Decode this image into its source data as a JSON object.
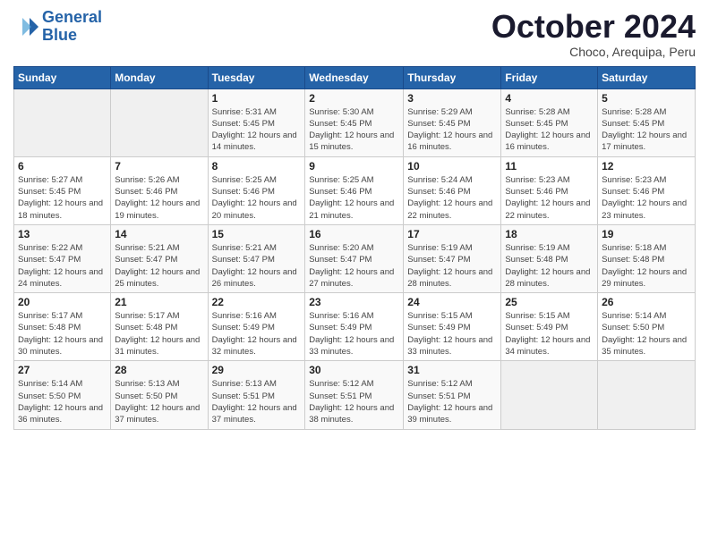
{
  "logo": {
    "line1": "General",
    "line2": "Blue"
  },
  "title": "October 2024",
  "subtitle": "Choco, Arequipa, Peru",
  "days_header": [
    "Sunday",
    "Monday",
    "Tuesday",
    "Wednesday",
    "Thursday",
    "Friday",
    "Saturday"
  ],
  "weeks": [
    [
      {
        "num": "",
        "info": ""
      },
      {
        "num": "",
        "info": ""
      },
      {
        "num": "1",
        "info": "Sunrise: 5:31 AM\nSunset: 5:45 PM\nDaylight: 12 hours and 14 minutes."
      },
      {
        "num": "2",
        "info": "Sunrise: 5:30 AM\nSunset: 5:45 PM\nDaylight: 12 hours and 15 minutes."
      },
      {
        "num": "3",
        "info": "Sunrise: 5:29 AM\nSunset: 5:45 PM\nDaylight: 12 hours and 16 minutes."
      },
      {
        "num": "4",
        "info": "Sunrise: 5:28 AM\nSunset: 5:45 PM\nDaylight: 12 hours and 16 minutes."
      },
      {
        "num": "5",
        "info": "Sunrise: 5:28 AM\nSunset: 5:45 PM\nDaylight: 12 hours and 17 minutes."
      }
    ],
    [
      {
        "num": "6",
        "info": "Sunrise: 5:27 AM\nSunset: 5:45 PM\nDaylight: 12 hours and 18 minutes."
      },
      {
        "num": "7",
        "info": "Sunrise: 5:26 AM\nSunset: 5:46 PM\nDaylight: 12 hours and 19 minutes."
      },
      {
        "num": "8",
        "info": "Sunrise: 5:25 AM\nSunset: 5:46 PM\nDaylight: 12 hours and 20 minutes."
      },
      {
        "num": "9",
        "info": "Sunrise: 5:25 AM\nSunset: 5:46 PM\nDaylight: 12 hours and 21 minutes."
      },
      {
        "num": "10",
        "info": "Sunrise: 5:24 AM\nSunset: 5:46 PM\nDaylight: 12 hours and 22 minutes."
      },
      {
        "num": "11",
        "info": "Sunrise: 5:23 AM\nSunset: 5:46 PM\nDaylight: 12 hours and 22 minutes."
      },
      {
        "num": "12",
        "info": "Sunrise: 5:23 AM\nSunset: 5:46 PM\nDaylight: 12 hours and 23 minutes."
      }
    ],
    [
      {
        "num": "13",
        "info": "Sunrise: 5:22 AM\nSunset: 5:47 PM\nDaylight: 12 hours and 24 minutes."
      },
      {
        "num": "14",
        "info": "Sunrise: 5:21 AM\nSunset: 5:47 PM\nDaylight: 12 hours and 25 minutes."
      },
      {
        "num": "15",
        "info": "Sunrise: 5:21 AM\nSunset: 5:47 PM\nDaylight: 12 hours and 26 minutes."
      },
      {
        "num": "16",
        "info": "Sunrise: 5:20 AM\nSunset: 5:47 PM\nDaylight: 12 hours and 27 minutes."
      },
      {
        "num": "17",
        "info": "Sunrise: 5:19 AM\nSunset: 5:47 PM\nDaylight: 12 hours and 28 minutes."
      },
      {
        "num": "18",
        "info": "Sunrise: 5:19 AM\nSunset: 5:48 PM\nDaylight: 12 hours and 28 minutes."
      },
      {
        "num": "19",
        "info": "Sunrise: 5:18 AM\nSunset: 5:48 PM\nDaylight: 12 hours and 29 minutes."
      }
    ],
    [
      {
        "num": "20",
        "info": "Sunrise: 5:17 AM\nSunset: 5:48 PM\nDaylight: 12 hours and 30 minutes."
      },
      {
        "num": "21",
        "info": "Sunrise: 5:17 AM\nSunset: 5:48 PM\nDaylight: 12 hours and 31 minutes."
      },
      {
        "num": "22",
        "info": "Sunrise: 5:16 AM\nSunset: 5:49 PM\nDaylight: 12 hours and 32 minutes."
      },
      {
        "num": "23",
        "info": "Sunrise: 5:16 AM\nSunset: 5:49 PM\nDaylight: 12 hours and 33 minutes."
      },
      {
        "num": "24",
        "info": "Sunrise: 5:15 AM\nSunset: 5:49 PM\nDaylight: 12 hours and 33 minutes."
      },
      {
        "num": "25",
        "info": "Sunrise: 5:15 AM\nSunset: 5:49 PM\nDaylight: 12 hours and 34 minutes."
      },
      {
        "num": "26",
        "info": "Sunrise: 5:14 AM\nSunset: 5:50 PM\nDaylight: 12 hours and 35 minutes."
      }
    ],
    [
      {
        "num": "27",
        "info": "Sunrise: 5:14 AM\nSunset: 5:50 PM\nDaylight: 12 hours and 36 minutes."
      },
      {
        "num": "28",
        "info": "Sunrise: 5:13 AM\nSunset: 5:50 PM\nDaylight: 12 hours and 37 minutes."
      },
      {
        "num": "29",
        "info": "Sunrise: 5:13 AM\nSunset: 5:51 PM\nDaylight: 12 hours and 37 minutes."
      },
      {
        "num": "30",
        "info": "Sunrise: 5:12 AM\nSunset: 5:51 PM\nDaylight: 12 hours and 38 minutes."
      },
      {
        "num": "31",
        "info": "Sunrise: 5:12 AM\nSunset: 5:51 PM\nDaylight: 12 hours and 39 minutes."
      },
      {
        "num": "",
        "info": ""
      },
      {
        "num": "",
        "info": ""
      }
    ]
  ]
}
